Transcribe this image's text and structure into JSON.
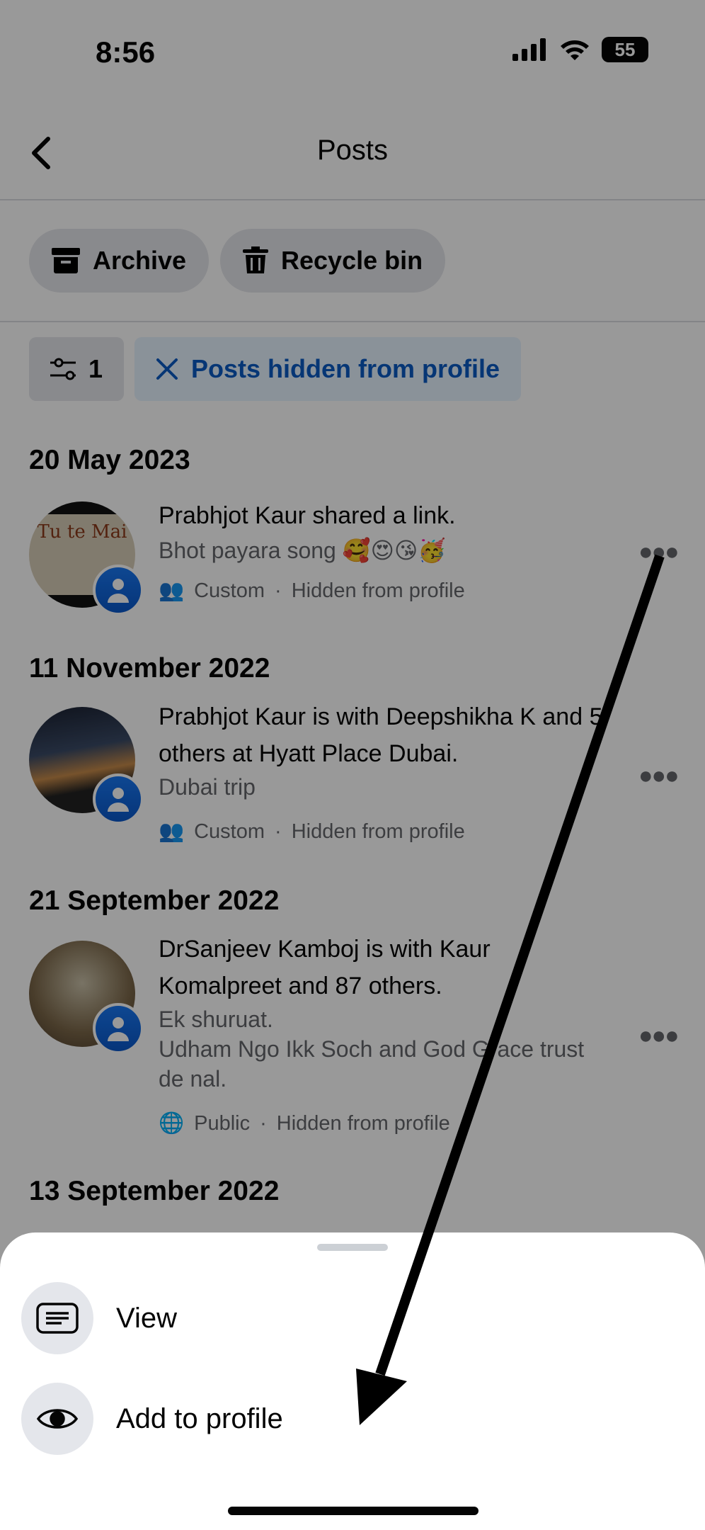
{
  "status_bar": {
    "time": "8:56",
    "battery": "55"
  },
  "header": {
    "title": "Posts",
    "back_icon": "chevron-left-icon"
  },
  "actions": {
    "archive": "Archive",
    "recycle_bin": "Recycle bin"
  },
  "filters": {
    "count": "1",
    "active_filter": "Posts hidden from profile"
  },
  "posts": [
    {
      "date": "20 May 2023",
      "title": "Prabhjot Kaur shared a link.",
      "caption": "Bhot payara song 🥰😍😘🥳",
      "audience": "Custom",
      "visibility": "Hidden from profile",
      "thumb_text": "Tu te Mai"
    },
    {
      "date": "11 November 2022",
      "title": "Prabhjot Kaur is with Deepshikha K and 5 others at Hyatt Place Dubai.",
      "caption": "Dubai trip",
      "audience": "Custom",
      "visibility": "Hidden from profile"
    },
    {
      "date": "21 September 2022",
      "title": "DrSanjeev Kamboj is with Kaur Komalpreet and 87 others.",
      "caption": "Ek shuruat.\nUdham Ngo Ikk Soch and God Grace trust de nal.",
      "audience": "Public",
      "visibility": "Hidden from profile"
    },
    {
      "date": "13 September 2022"
    }
  ],
  "sheet": {
    "view": "View",
    "add_to_profile": "Add to profile"
  },
  "colors": {
    "accent": "#1877f2",
    "chip_active_bg": "#e7f3ff",
    "chip_active_text": "#0a5ac4"
  }
}
